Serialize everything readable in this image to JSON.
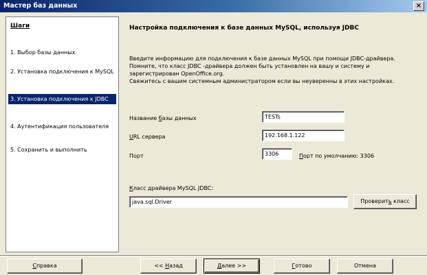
{
  "window": {
    "title": "Мастер баз данных",
    "close_glyph": "×"
  },
  "sidebar": {
    "title": "Шаги",
    "items": [
      {
        "label": "1. Выбор базы данных",
        "active": false
      },
      {
        "label": "2. Установка подключения к MySQL",
        "active": false
      },
      {
        "label": "3. Установка подключения к JDBC",
        "active": true
      },
      {
        "label": "4. Аутентификация пользователя",
        "active": false
      },
      {
        "label": "5. Сохранить и выполнить",
        "active": false
      }
    ]
  },
  "main": {
    "title": "Настройка подключения к базе данных MySQL, используя JDBC",
    "description": "Введите информацию для подключения к базе данных MySQL при помощи JDBC-драйвера. Помните, что класс JDBC -драйвера должен быть установлен на вашу и систему и зарегистрирован OpenOffice.org.\nСвяжитесь с вашим системным администратором если вы неуверенны в этих настройках.",
    "db_name": {
      "label_pre": "Название ",
      "label_mnemonic": "б",
      "label_post": "азы данных",
      "value": "TESTs"
    },
    "server_url": {
      "label_mnemonic": "U",
      "label_post": "RL сервера",
      "value": "192.168.1.122"
    },
    "port": {
      "label": "Порт",
      "value": "3306",
      "default_mnemonic": "П",
      "default_label_post": "орт по умолчанию: 3306"
    },
    "driver_class": {
      "label_mnemonic": "К",
      "label_post": "ласс драйвера MySQL JDBC:",
      "value": "java.sql.Driver"
    },
    "test_class_button": {
      "pre": "Проверит",
      "mnemonic": "ь",
      "post": " класс"
    }
  },
  "footer": {
    "help": {
      "mnemonic": "С",
      "post": "правка"
    },
    "back": {
      "pre": "<< ",
      "mnemonic": "Н",
      "post": "азад"
    },
    "next": {
      "mnemonic": "Д",
      "post": "алее >>"
    },
    "finish": {
      "mnemonic": "Г",
      "post": "отово"
    },
    "cancel": "Отмена"
  }
}
